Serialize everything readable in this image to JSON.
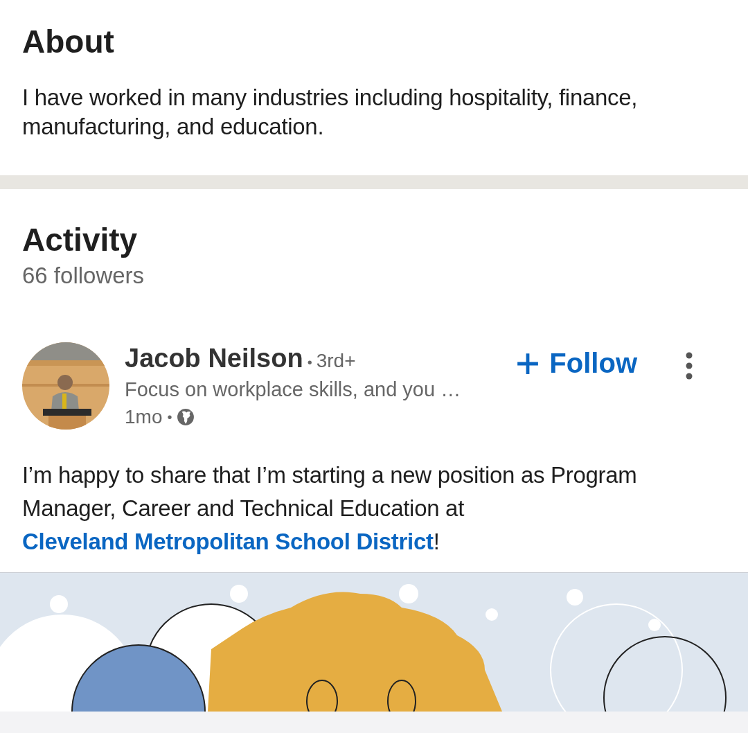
{
  "about": {
    "title": "About",
    "text": "I have worked in many industries including hospitality, finance, manufacturing, and education."
  },
  "activity": {
    "title": "Activity",
    "followers": "66 followers",
    "post": {
      "author": "Jacob Neilson",
      "separator": "•",
      "degree": "3rd+",
      "headline": "Focus on workplace skills, and you …",
      "time": "1mo",
      "time_separator": "•",
      "follow_label": "Follow",
      "text": "I’m happy to share that I’m starting a new position as Program Manager, Career and Technical Education at ",
      "link": "Cleveland Metropolitan School District",
      "text_end": "!"
    }
  }
}
